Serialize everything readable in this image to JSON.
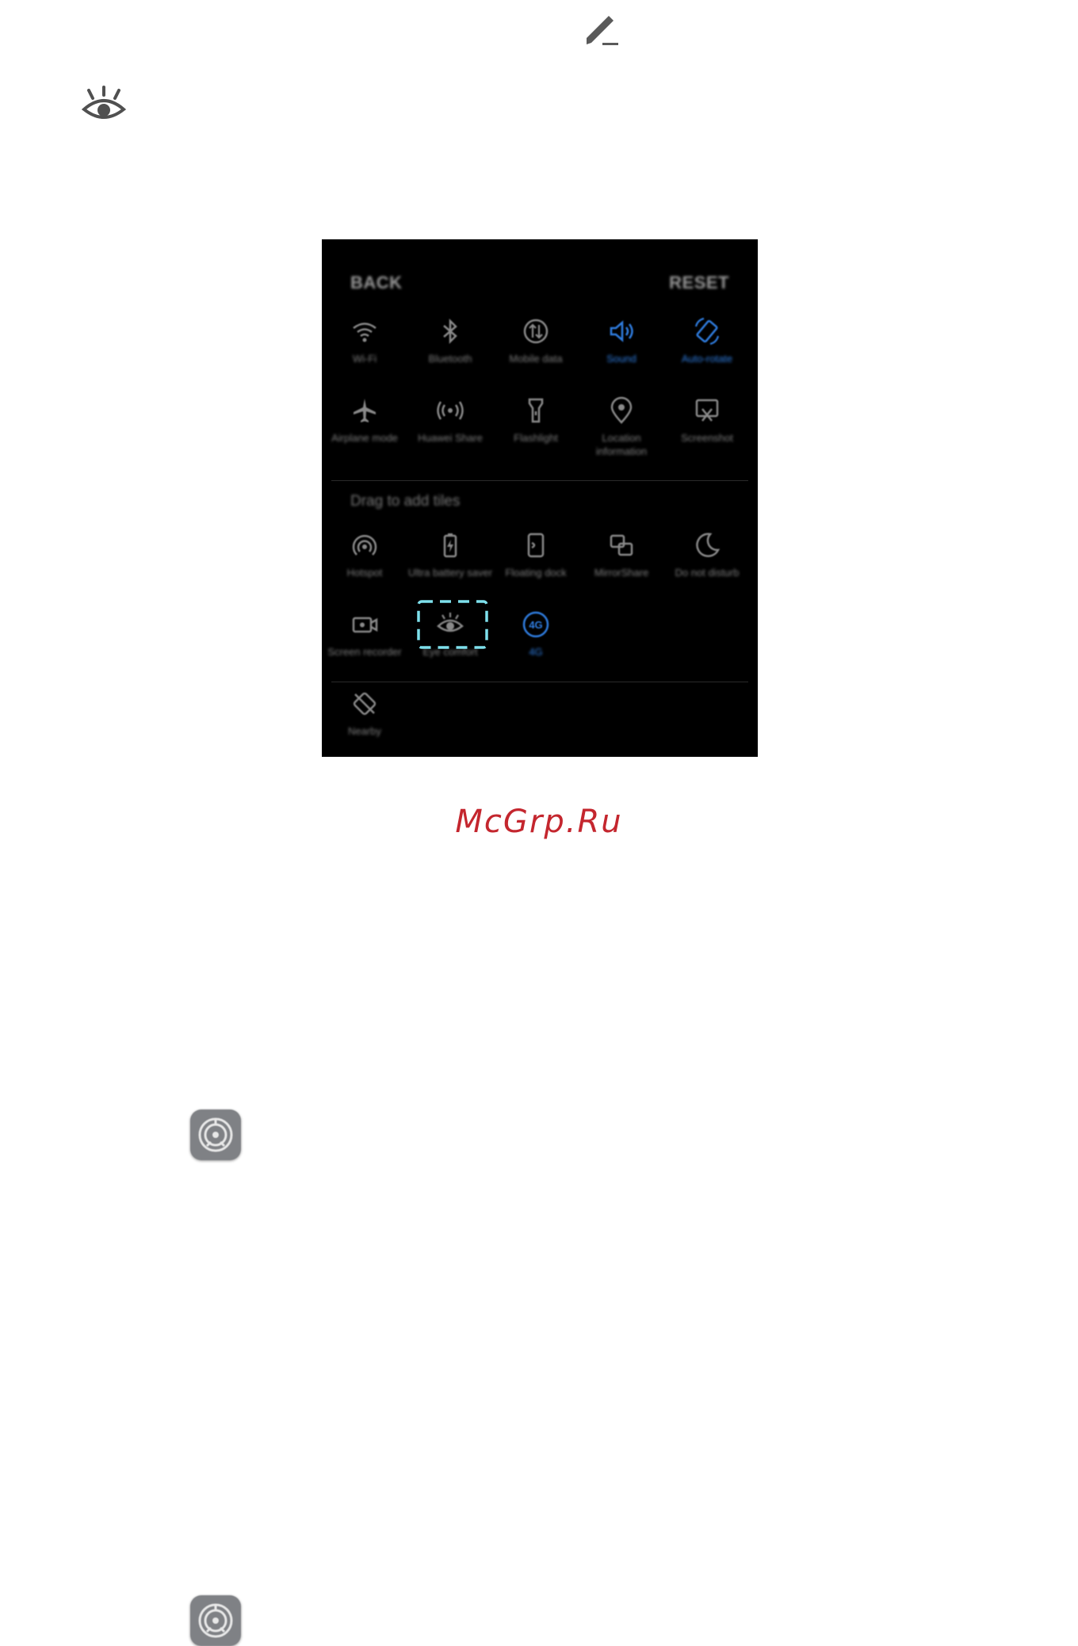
{
  "phone": {
    "header": {
      "back": "BACK",
      "reset": "RESET"
    },
    "active_tiles": [
      {
        "label": "Wi-Fi",
        "icon": "wifi-icon",
        "active": false
      },
      {
        "label": "Bluetooth",
        "icon": "bluetooth-icon",
        "active": false
      },
      {
        "label": "Mobile data",
        "icon": "mobile-data-icon",
        "active": false
      },
      {
        "label": "Sound",
        "icon": "sound-icon",
        "active": true
      },
      {
        "label": "Auto-rotate",
        "icon": "auto-rotate-icon",
        "active": true
      },
      {
        "label": "Airplane mode",
        "icon": "airplane-icon",
        "active": false
      },
      {
        "label": "Huawei Share",
        "icon": "huawei-share-icon",
        "active": false
      },
      {
        "label": "Flashlight",
        "icon": "flashlight-icon",
        "active": false
      },
      {
        "label": "Location information",
        "icon": "location-icon",
        "active": false
      },
      {
        "label": "Screenshot",
        "icon": "screenshot-icon",
        "active": false
      }
    ],
    "drag_label": "Drag to add tiles",
    "inactive_tiles": [
      {
        "label": "Hotspot",
        "icon": "hotspot-icon",
        "active": false
      },
      {
        "label": "Ultra battery saver",
        "icon": "battery-icon",
        "active": false
      },
      {
        "label": "Floating dock",
        "icon": "floating-dock-icon",
        "active": false
      },
      {
        "label": "MirrorShare",
        "icon": "mirrorshare-icon",
        "active": false
      },
      {
        "label": "Do not disturb",
        "icon": "moon-icon",
        "active": false
      },
      {
        "label": "Screen recorder",
        "icon": "screen-recorder-icon",
        "active": false
      },
      {
        "label": "Eye comfort",
        "icon": "eye-icon",
        "active": false
      },
      {
        "label": "4G",
        "icon": "4g-icon",
        "active": true
      },
      {
        "label": "Nearby",
        "icon": "nearby-icon",
        "active": false
      }
    ]
  },
  "watermark": "McGrp.Ru",
  "colors": {
    "accent_blue": "#2f7de0",
    "highlight_cyan": "#7ee0ec",
    "watermark_red": "#c4262e",
    "panel_bg": "#000000"
  }
}
